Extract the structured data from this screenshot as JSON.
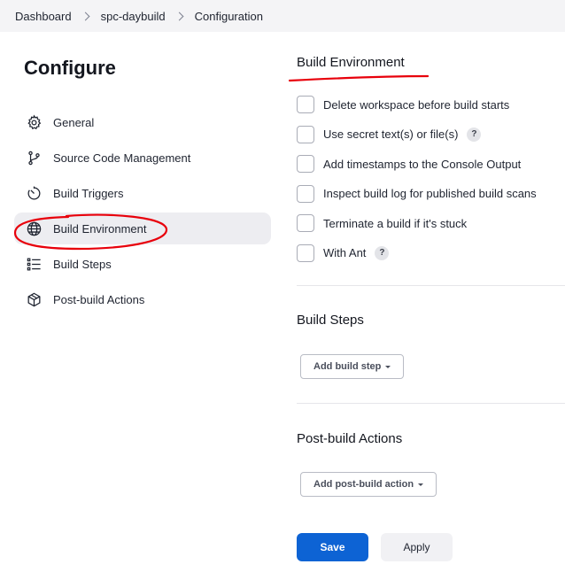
{
  "breadcrumb": {
    "items": [
      "Dashboard",
      "spc-daybuild",
      "Configuration"
    ]
  },
  "page": {
    "title": "Configure"
  },
  "sidebar": {
    "items": [
      {
        "label": "General",
        "icon": "gear-icon"
      },
      {
        "label": "Source Code Management",
        "icon": "branch-icon"
      },
      {
        "label": "Build Triggers",
        "icon": "timer-icon"
      },
      {
        "label": "Build Environment",
        "icon": "globe-icon",
        "active": true
      },
      {
        "label": "Build Steps",
        "icon": "list-icon"
      },
      {
        "label": "Post-build Actions",
        "icon": "package-icon"
      }
    ]
  },
  "build_environment": {
    "title": "Build Environment",
    "options": [
      {
        "label": "Delete workspace before build starts",
        "checked": false,
        "help": false
      },
      {
        "label": "Use secret text(s) or file(s)",
        "checked": false,
        "help": true
      },
      {
        "label": "Add timestamps to the Console Output",
        "checked": false,
        "help": false
      },
      {
        "label": "Inspect build log for published build scans",
        "checked": false,
        "help": false
      },
      {
        "label": "Terminate a build if it's stuck",
        "checked": false,
        "help": false
      },
      {
        "label": "With Ant",
        "checked": false,
        "help": true
      }
    ],
    "help_glyph": "?"
  },
  "build_steps": {
    "title": "Build Steps",
    "add_label": "Add build step"
  },
  "post_build": {
    "title": "Post-build Actions",
    "add_label": "Add post-build action"
  },
  "actions": {
    "save_label": "Save",
    "apply_label": "Apply"
  },
  "colors": {
    "primary": "#0d63d4",
    "annotation": "#e8000b"
  }
}
